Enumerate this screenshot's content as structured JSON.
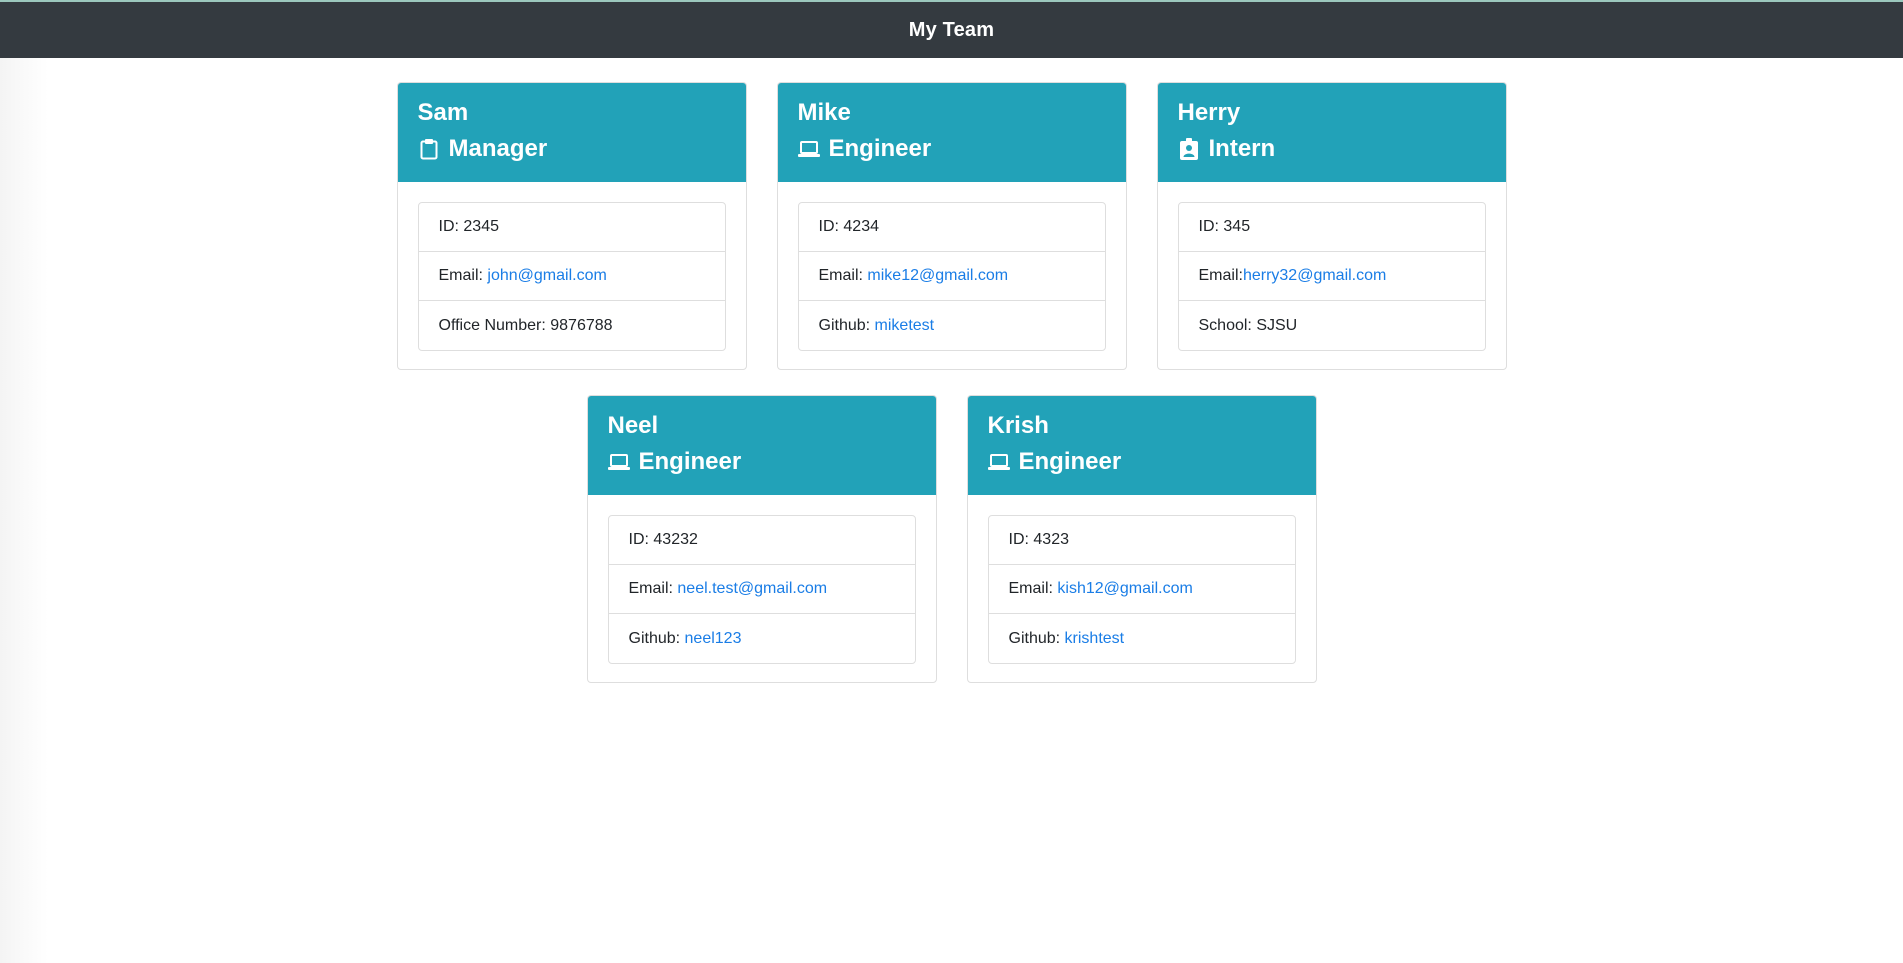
{
  "navbar": {
    "title": "My Team"
  },
  "colors": {
    "navbar_bg": "#343a40",
    "card_header_bg": "#22a2b8",
    "link": "#1a7de6"
  },
  "team": [
    {
      "name": "Sam",
      "role": "Manager",
      "icon": "clipboard-icon",
      "id_text": "ID: 2345",
      "email_label": "Email: ",
      "email": "john@gmail.com",
      "extra_label": "Office Number: 9876788",
      "extra_link": ""
    },
    {
      "name": "Mike",
      "role": "Engineer",
      "icon": "laptop-icon",
      "id_text": "ID: 4234",
      "email_label": "Email: ",
      "email": "mike12@gmail.com",
      "extra_label": "Github: ",
      "extra_link": "miketest"
    },
    {
      "name": "Herry",
      "role": "Intern",
      "icon": "id-badge-icon",
      "id_text": "ID: 345",
      "email_label": "Email:",
      "email": "herry32@gmail.com",
      "extra_label": "School: SJSU",
      "extra_link": ""
    },
    {
      "name": "Neel",
      "role": "Engineer",
      "icon": "laptop-icon",
      "id_text": "ID: 43232",
      "email_label": "Email: ",
      "email": "neel.test@gmail.com",
      "extra_label": "Github: ",
      "extra_link": "neel123"
    },
    {
      "name": "Krish",
      "role": "Engineer",
      "icon": "laptop-icon",
      "id_text": "ID: 4323",
      "email_label": "Email: ",
      "email": "kish12@gmail.com",
      "extra_label": "Github: ",
      "extra_link": "krishtest"
    }
  ]
}
